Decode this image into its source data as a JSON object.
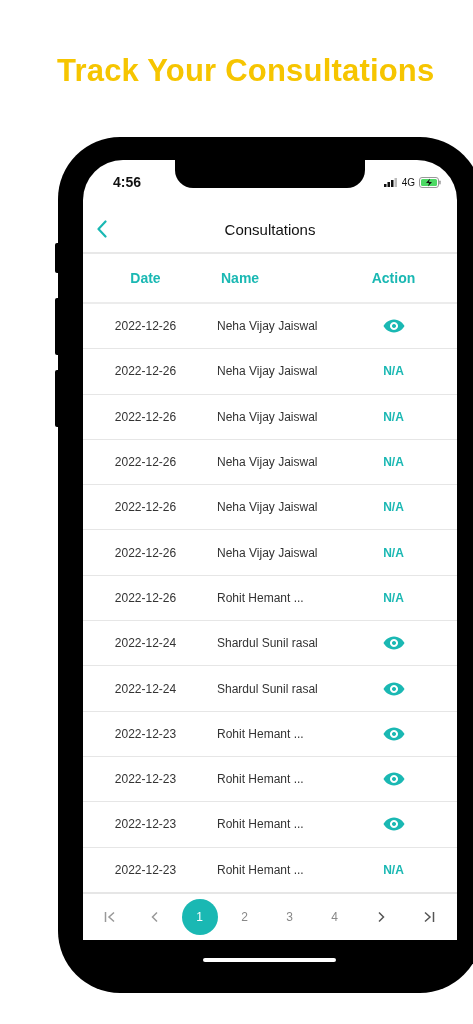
{
  "headline": "Track Your Consultations",
  "status_bar": {
    "time": "4:56",
    "network": "4G",
    "charging": true
  },
  "header": {
    "title": "Consultations"
  },
  "table": {
    "columns": [
      "Date",
      "Name",
      "Action"
    ],
    "rows": [
      {
        "date": "2022-12-26",
        "name": "Neha Vijay Jaiswal",
        "action": {
          "kind": "view"
        }
      },
      {
        "date": "2022-12-26",
        "name": "Neha Vijay Jaiswal",
        "action": {
          "kind": "text",
          "label": "N/A"
        }
      },
      {
        "date": "2022-12-26",
        "name": "Neha Vijay Jaiswal",
        "action": {
          "kind": "text",
          "label": "N/A"
        }
      },
      {
        "date": "2022-12-26",
        "name": "Neha Vijay Jaiswal",
        "action": {
          "kind": "text",
          "label": "N/A"
        }
      },
      {
        "date": "2022-12-26",
        "name": "Neha Vijay Jaiswal",
        "action": {
          "kind": "text",
          "label": "N/A"
        }
      },
      {
        "date": "2022-12-26",
        "name": "Neha Vijay Jaiswal",
        "action": {
          "kind": "text",
          "label": "N/A"
        }
      },
      {
        "date": "2022-12-26",
        "name": "Rohit Hemant ...",
        "action": {
          "kind": "text",
          "label": "N/A"
        }
      },
      {
        "date": "2022-12-24",
        "name": "Shardul Sunil rasal",
        "action": {
          "kind": "view"
        }
      },
      {
        "date": "2022-12-24",
        "name": "Shardul Sunil rasal",
        "action": {
          "kind": "view"
        }
      },
      {
        "date": "2022-12-23",
        "name": "Rohit Hemant ...",
        "action": {
          "kind": "view"
        }
      },
      {
        "date": "2022-12-23",
        "name": "Rohit Hemant ...",
        "action": {
          "kind": "view"
        }
      },
      {
        "date": "2022-12-23",
        "name": "Rohit Hemant ...",
        "action": {
          "kind": "view"
        }
      },
      {
        "date": "2022-12-23",
        "name": "Rohit Hemant ...",
        "action": {
          "kind": "text",
          "label": "N/A"
        }
      }
    ]
  },
  "pagination": [
    {
      "kind": "first"
    },
    {
      "kind": "prev"
    },
    {
      "kind": "page",
      "label": "1",
      "selected": true
    },
    {
      "kind": "page",
      "label": "2",
      "selected": false
    },
    {
      "kind": "page",
      "label": "3",
      "selected": false
    },
    {
      "kind": "page",
      "label": "4",
      "selected": false
    },
    {
      "kind": "next"
    },
    {
      "kind": "last"
    }
  ]
}
